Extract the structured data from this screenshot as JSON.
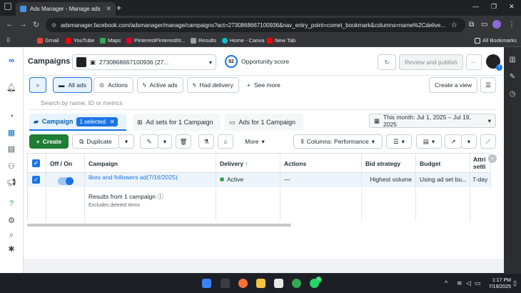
{
  "browser": {
    "tab_title": "Ads Manager - Manage ads - C",
    "url": "adsmanager.facebook.com/adsmanager/manage/campaigns?act=2730868667100936&nav_entry_point=comet_bookmark&columns=name%2Cdelive...",
    "bookmarks": [
      {
        "label": "Gmail",
        "icon": "gmail-icon",
        "color": "#ea4335"
      },
      {
        "label": "YouTube",
        "icon": "youtube-icon",
        "color": "#ff0000"
      },
      {
        "label": "Maps",
        "icon": "maps-icon",
        "color": "#34a853"
      },
      {
        "label": "PinterestPinterestht...",
        "icon": "pinterest-icon",
        "color": "#e60023"
      },
      {
        "label": "Results",
        "icon": "globe-icon",
        "color": "#9aa0a6"
      },
      {
        "label": "Home - Canva",
        "icon": "canva-icon",
        "color": "#00c4cc"
      },
      {
        "label": "New Tab",
        "icon": "youtube-icon",
        "color": "#ff0000"
      }
    ],
    "all_bookmarks": "All Bookmarks"
  },
  "header": {
    "title": "Campaigns",
    "account": "2730868667100936 (27...",
    "score": "82",
    "score_label": "Opportunity score",
    "review_button": "Review and publish",
    "more_button": "···"
  },
  "filters": {
    "all_ads": "All ads",
    "actions": "Actions",
    "active_ads": "Active ads",
    "had_delivery": "Had delivery",
    "see_more": "See more",
    "create_view": "Create a view"
  },
  "search": {
    "placeholder": "Search by name, ID or metrics"
  },
  "tabs": {
    "campaigns": "Campaign",
    "selected_chip": "1 selected",
    "ad_sets": "Ad sets for 1 Campaign",
    "ads": "Ads for 1 Campaign",
    "date_range": "This month: Jul 1, 2025 – Jul 19, 2025"
  },
  "toolbar": {
    "create": "Create",
    "duplicate": "Duplicate",
    "more": "More",
    "columns": "Columns: Performance"
  },
  "table": {
    "headers": [
      "Off / On",
      "Campaign",
      "Delivery",
      "Actions",
      "Bid strategy",
      "Budget",
      "Attri setti"
    ],
    "row": {
      "campaign": "likes and followers ad(7/16/2025)",
      "delivery": "Active",
      "actions": "—",
      "bid_strategy": "Highest volume",
      "budget": "Using ad set bu...",
      "attribution": "7-day"
    },
    "results_text": "Results from 1 campaign",
    "excludes_text": "Excludes deleted items"
  },
  "taskbar": {
    "time": "1:17 PM",
    "date": "7/19/2025",
    "badge": "1"
  },
  "colors": {
    "accent": "#1b74e4",
    "create_green": "#1e7e34",
    "active_green": "#31a24c"
  }
}
